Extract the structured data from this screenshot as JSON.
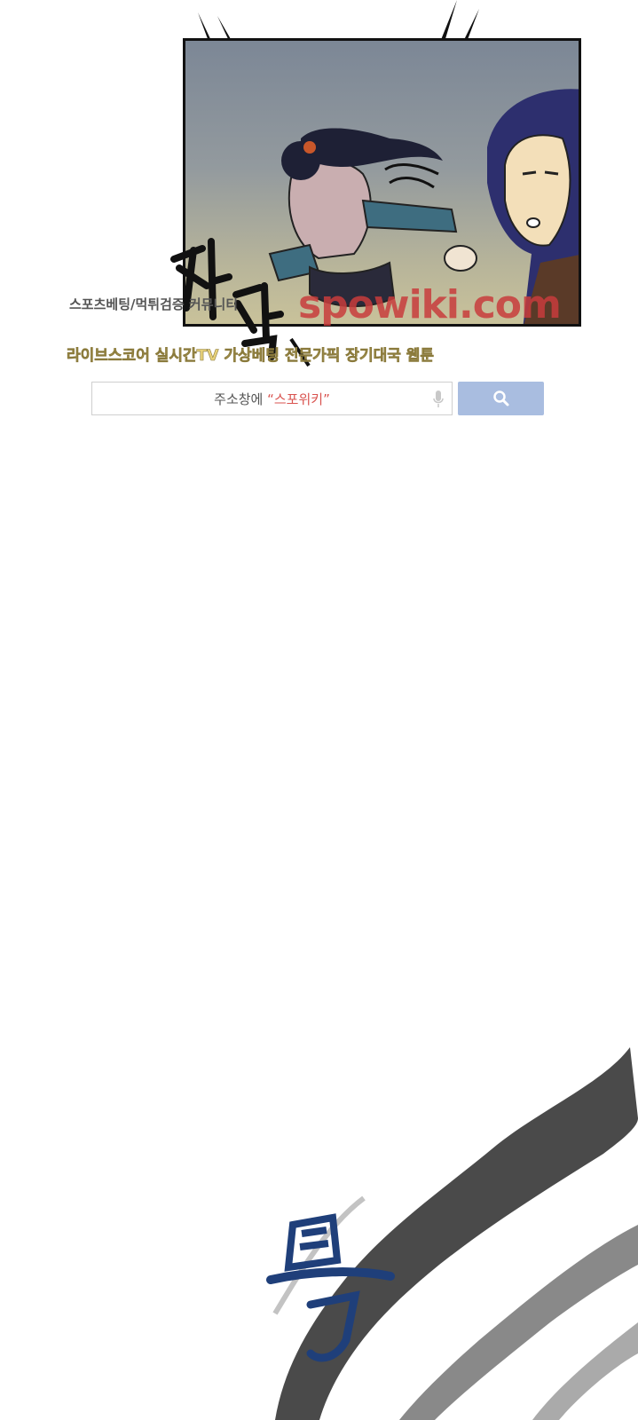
{
  "watermark": {
    "line1": "스포츠베팅/먹튀검증 커뮤니티",
    "logo": "spowiki.com",
    "line2": "라이브스코어 실시간TV 가상베팅 전문가픽 장기대국 웹툰"
  },
  "search": {
    "prefix": "주소창에 ",
    "keyword": "“스포위키”"
  },
  "icons": {
    "mic": "microphone-icon",
    "search": "search-icon"
  },
  "colors": {
    "logo": "#c83c3c",
    "line2": "#e8d27a",
    "search_button": "#a9bde0",
    "brush_accent": "#1f3f7a"
  }
}
